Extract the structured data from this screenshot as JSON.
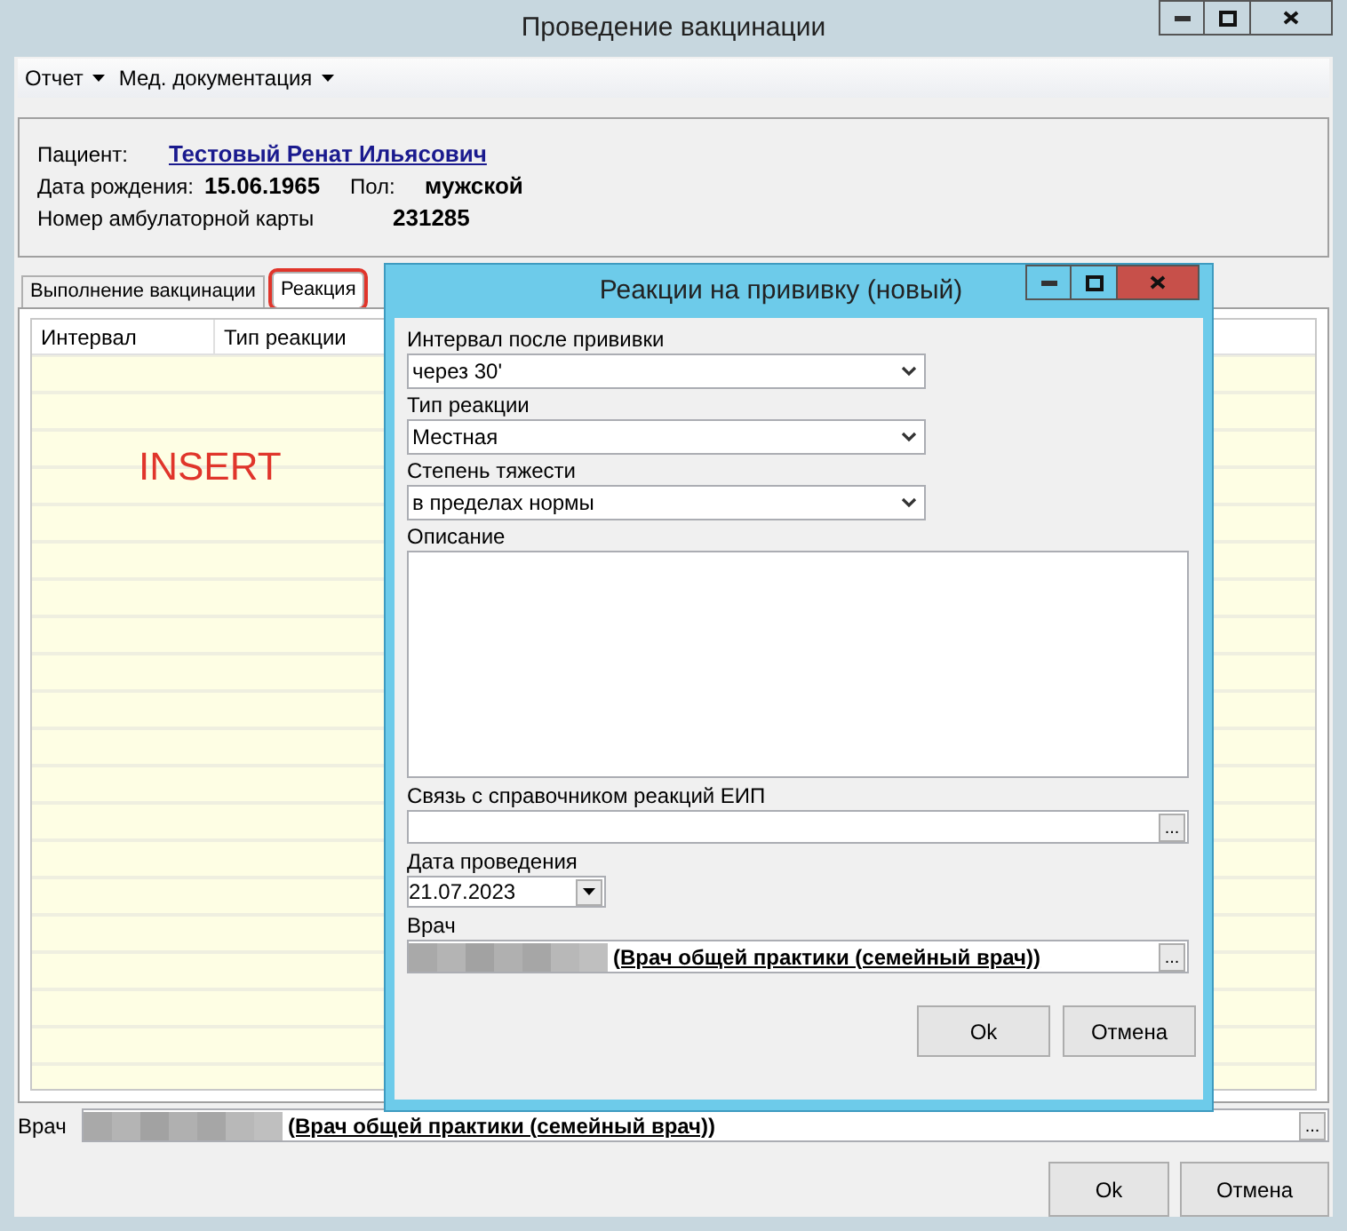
{
  "window": {
    "title": "Проведение вакцинации"
  },
  "menu": [
    {
      "label": "Отчет"
    },
    {
      "label": "Мед. документация"
    }
  ],
  "patient": {
    "patient_label": "Пациент:",
    "patient_name": "Тестовый Ренат Ильясович",
    "birth_label": "Дата рождения:",
    "birth_date": "15.06.1965",
    "sex_label": "Пол:",
    "sex": "мужской",
    "card_label": "Номер амбулаторной карты",
    "card_number": "231285"
  },
  "tabs": [
    {
      "label": "Выполнение вакцинации",
      "selected": false,
      "highlighted": false
    },
    {
      "label": "Реакция",
      "selected": true,
      "highlighted": true
    }
  ],
  "table": {
    "columns": [
      "Интервал",
      "Тип реакции"
    ],
    "annotation": "INSERT"
  },
  "doctor": {
    "label": "Врач",
    "value": "(Врач общей практики (семейный врач))",
    "button": "..."
  },
  "buttons": [
    "Ok",
    "Отмена"
  ],
  "dialog": {
    "title": "Реакции на прививку (новый)",
    "fields": [
      {
        "kind": "combo",
        "label": "Интервал после прививки",
        "value": "через 30'"
      },
      {
        "kind": "combo",
        "label": "Тип реакции",
        "value": "Местная"
      },
      {
        "kind": "combo",
        "label": "Степень тяжести",
        "value": "в пределах нормы"
      },
      {
        "kind": "memo",
        "label": "Описание"
      },
      {
        "kind": "lookup",
        "label": "Связь с справочником реакций ЕИП",
        "button": "..."
      },
      {
        "kind": "date",
        "label": "Дата проведения",
        "value": "21.07.2023"
      },
      {
        "kind": "doctor",
        "label": "Врач",
        "value": "(Врач общей практики (семейный врач))",
        "button": "..."
      }
    ],
    "buttons": [
      "Ok",
      "Отмена"
    ]
  }
}
